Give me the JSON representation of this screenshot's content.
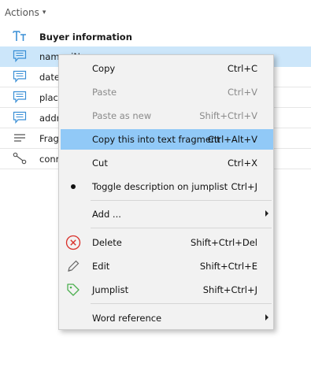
{
  "header": {
    "title": "Actions",
    "caret": "▾"
  },
  "rows": [
    {
      "text": "Buyer information"
    },
    {
      "text": "name: iName:"
    },
    {
      "text": "date_"
    },
    {
      "text": "place"
    },
    {
      "text": "addr"
    },
    {
      "text": "Frag"
    },
    {
      "text": "conn"
    }
  ],
  "menu": {
    "items": [
      {
        "label": "Copy",
        "shortcut": "Ctrl+C"
      },
      {
        "label": "Paste",
        "shortcut": "Ctrl+V"
      },
      {
        "label": "Paste as new",
        "shortcut": "Shift+Ctrl+V"
      },
      {
        "label": "Copy this into text fragment",
        "shortcut": "Ctrl+Alt+V"
      },
      {
        "label": "Cut",
        "shortcut": "Ctrl+X"
      },
      {
        "label": "Toggle description on jumplist",
        "shortcut": "Ctrl+J"
      },
      {
        "label": "Add ...",
        "shortcut": ""
      },
      {
        "label": "Delete",
        "shortcut": "Shift+Ctrl+Del"
      },
      {
        "label": "Edit",
        "shortcut": "Shift+Ctrl+E"
      },
      {
        "label": "Jumplist",
        "shortcut": "Shift+Ctrl+J"
      },
      {
        "label": "Word reference",
        "shortcut": ""
      }
    ]
  },
  "colors": {
    "selection": "#cce6fa",
    "highlight": "#91c9f7",
    "delete_red": "#d9302a",
    "jumplist_green": "#4caf50",
    "icon_blue": "#3a8fd6"
  }
}
